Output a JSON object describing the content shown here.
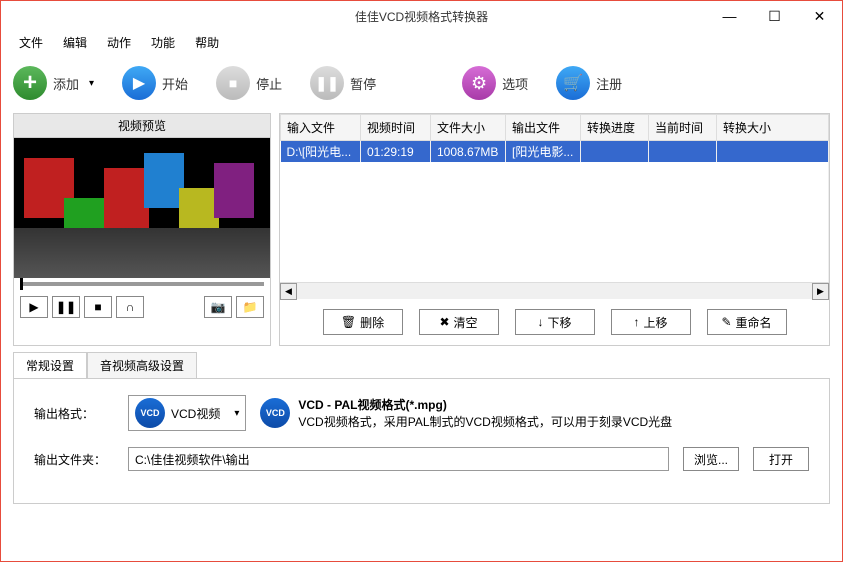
{
  "title": "佳佳VCD视频格式转换器",
  "menu": {
    "file": "文件",
    "edit": "编辑",
    "action": "动作",
    "function": "功能",
    "help": "帮助"
  },
  "toolbar": {
    "add": "添加",
    "start": "开始",
    "stop": "停止",
    "pause": "暂停",
    "options": "选项",
    "register": "注册"
  },
  "preview": {
    "title": "视频预览"
  },
  "table": {
    "headers": {
      "input": "输入文件",
      "duration": "视频时间",
      "size": "文件大小",
      "output": "输出文件",
      "progress": "转换进度",
      "curtime": "当前时间",
      "outsize": "转换大小"
    },
    "rows": [
      {
        "input": "D:\\[阳光电...",
        "duration": "01:29:19",
        "size": "1008.67MB",
        "output": "[阳光电影...",
        "progress": "",
        "curtime": "",
        "outsize": ""
      }
    ]
  },
  "actions": {
    "delete": "删除",
    "clear": "清空",
    "movedown": "下移",
    "moveup": "上移",
    "rename": "重命名"
  },
  "tabs": {
    "general": "常规设置",
    "advanced": "音视频高级设置"
  },
  "settings": {
    "format_label": "输出格式：",
    "format_badge": "VCD",
    "format_name": "VCD视频",
    "format_title": "VCD - PAL视频格式(*.mpg)",
    "format_desc": "VCD视频格式，采用PAL制式的VCD视频格式，可以用于刻录VCD光盘",
    "folder_label": "输出文件夹：",
    "folder_path": "C:\\佳佳视频软件\\输出",
    "browse": "浏览...",
    "open": "打开"
  }
}
